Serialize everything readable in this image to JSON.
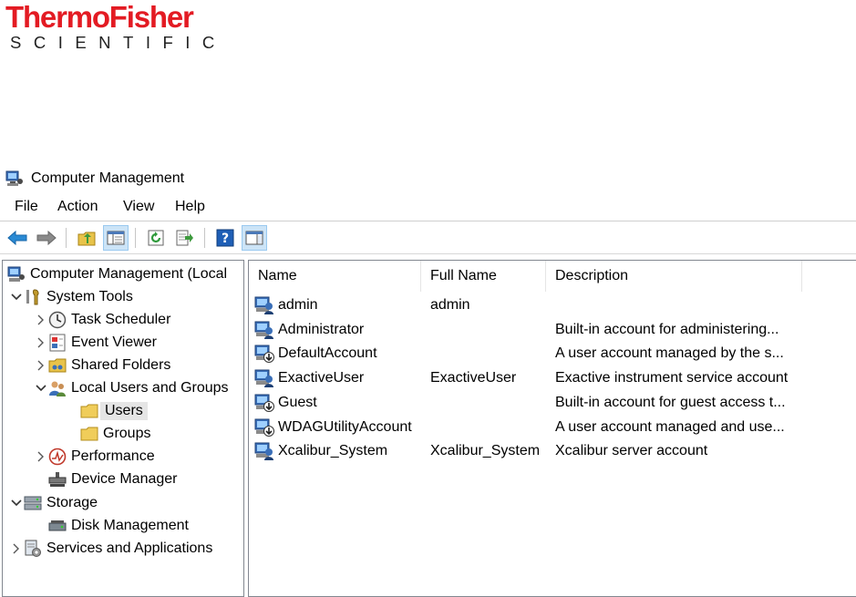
{
  "logo": {
    "line1": "ThermoFisher",
    "line2": "SCIENTIFIC",
    "brand_color": "#e31b23"
  },
  "window": {
    "title": "Computer Management"
  },
  "menu": [
    "File",
    "Action",
    "View",
    "Help"
  ],
  "toolbar": {
    "buttons": [
      "back-arrow-icon",
      "forward-arrow-icon",
      "up-folder-icon",
      "show-hide-tree-icon",
      "refresh-icon",
      "export-list-icon",
      "help-icon",
      "show-hide-action-pane-icon"
    ]
  },
  "tree": {
    "items": [
      {
        "label": "Computer Management (Local",
        "icon": "computer-management-icon"
      },
      {
        "label": "System Tools",
        "icon": "system-tools-icon",
        "state": "expanded"
      },
      {
        "label": "Task Scheduler",
        "icon": "clock-icon",
        "state": "collapsed"
      },
      {
        "label": "Event Viewer",
        "icon": "event-viewer-icon",
        "state": "collapsed"
      },
      {
        "label": "Shared Folders",
        "icon": "shared-folders-icon",
        "state": "collapsed"
      },
      {
        "label": "Local Users and Groups",
        "icon": "users-groups-icon",
        "state": "expanded"
      },
      {
        "label": "Users",
        "icon": "folder-icon",
        "selected": true
      },
      {
        "label": "Groups",
        "icon": "folder-icon"
      },
      {
        "label": "Performance",
        "icon": "performance-icon",
        "state": "collapsed"
      },
      {
        "label": "Device Manager",
        "icon": "device-manager-icon"
      },
      {
        "label": "Storage",
        "icon": "storage-icon",
        "state": "expanded"
      },
      {
        "label": "Disk Management",
        "icon": "disk-management-icon"
      },
      {
        "label": "Services and Applications",
        "icon": "services-icon",
        "state": "collapsed"
      }
    ]
  },
  "list": {
    "columns": [
      "Name",
      "Full Name",
      "Description"
    ],
    "rows": [
      {
        "name": "admin",
        "full_name": "admin",
        "description": "",
        "disabled": false
      },
      {
        "name": "Administrator",
        "full_name": "",
        "description": "Built-in account for administering...",
        "disabled": false
      },
      {
        "name": "DefaultAccount",
        "full_name": "",
        "description": "A user account managed by the s...",
        "disabled": true
      },
      {
        "name": "ExactiveUser",
        "full_name": "ExactiveUser",
        "description": "Exactive instrument service account",
        "disabled": false
      },
      {
        "name": "Guest",
        "full_name": "",
        "description": "Built-in account for guest access t...",
        "disabled": true
      },
      {
        "name": "WDAGUtilityAccount",
        "full_name": "",
        "description": "A user account managed and use...",
        "disabled": true
      },
      {
        "name": "Xcalibur_System",
        "full_name": "Xcalibur_System",
        "description": "Xcalibur server account",
        "disabled": false
      }
    ]
  }
}
